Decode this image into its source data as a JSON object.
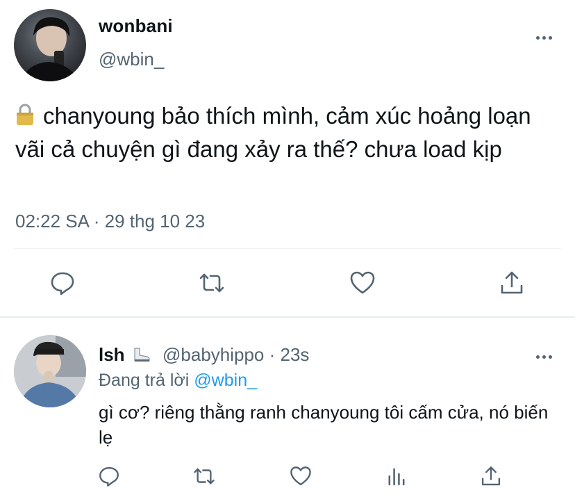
{
  "main_tweet": {
    "display_name": "wonbani",
    "handle": "@wbin_",
    "text": "chanyoung bảo thích mình, cảm xúc hoảng loạn vãi cả chuyện gì đang xảy ra thế? chưa load kịp",
    "timestamp": "02:22 SA · 29 thg 10 23",
    "icons": {
      "lock": "lock-icon",
      "more": "more-icon",
      "reply": "reply-icon",
      "retweet": "retweet-icon",
      "like": "like-icon",
      "share": "share-icon"
    }
  },
  "reply_tweet": {
    "display_name": "lsh",
    "handle_time": "@babyhippo · 23s",
    "replying_prefix": "Đang trả lời",
    "replying_to": "@wbin_",
    "text": "gì cơ? riêng thằng ranh chanyoung tôi cấm cửa, nó biến lẹ",
    "icons": {
      "boot": "boot-emoji-icon",
      "more": "more-icon",
      "reply": "reply-icon",
      "retweet": "retweet-icon",
      "like": "like-icon",
      "views": "views-icon",
      "share": "share-icon"
    }
  },
  "colors": {
    "text": "#0f1419",
    "secondary": "#536471",
    "link": "#1d9bf0",
    "divider": "#eff3f4"
  }
}
